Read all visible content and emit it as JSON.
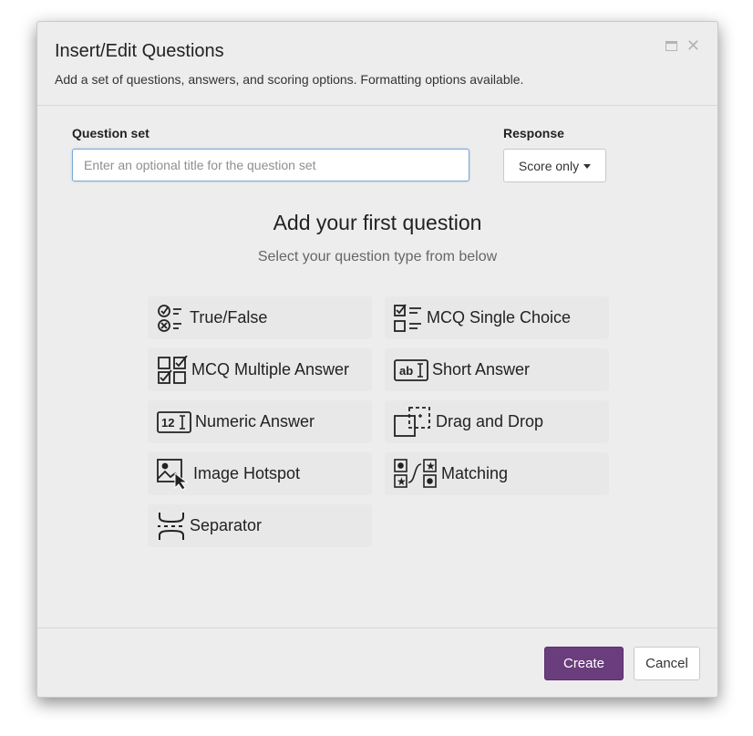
{
  "dialog": {
    "title": "Insert/Edit Questions",
    "subtitle": "Add a set of questions, answers, and scoring options. Formatting options available."
  },
  "question_set": {
    "label": "Question set",
    "value": "",
    "placeholder": "Enter an optional title for the question set"
  },
  "response": {
    "label": "Response",
    "selected": "Score only"
  },
  "main": {
    "heading": "Add your first question",
    "subheading": "Select your question type from below"
  },
  "question_types": [
    {
      "label": "True/False",
      "icon": "true-false-icon"
    },
    {
      "label": "MCQ Single Choice",
      "icon": "mcq-single-choice-icon"
    },
    {
      "label": "MCQ Multiple Answer",
      "icon": "mcq-multiple-answer-icon"
    },
    {
      "label": "Short Answer",
      "icon": "short-answer-icon"
    },
    {
      "label": "Numeric Answer",
      "icon": "numeric-answer-icon"
    },
    {
      "label": "Drag and Drop",
      "icon": "drag-and-drop-icon"
    },
    {
      "label": "Image Hotspot",
      "icon": "image-hotspot-icon"
    },
    {
      "label": "Matching",
      "icon": "matching-icon"
    },
    {
      "label": "Separator",
      "icon": "separator-icon"
    }
  ],
  "footer": {
    "create_label": "Create",
    "cancel_label": "Cancel"
  },
  "colors": {
    "primary": "#6a3e7c",
    "dialog_bg": "#ededed",
    "input_focus_border": "#7aa7d8"
  }
}
